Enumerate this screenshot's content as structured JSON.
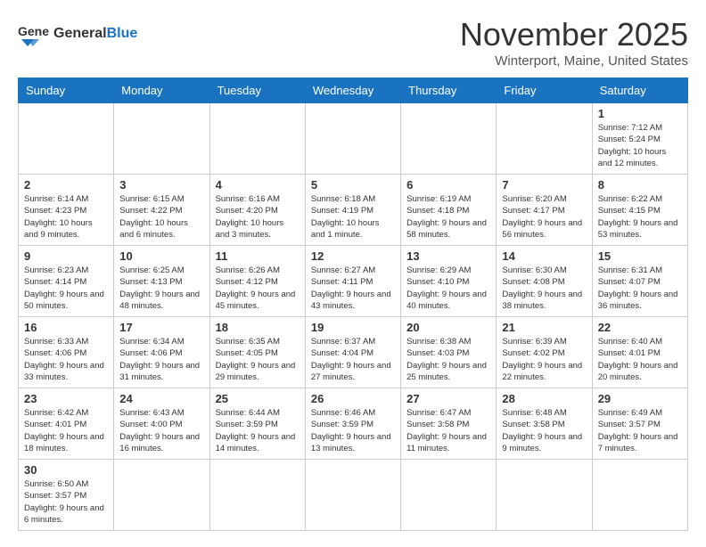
{
  "logo": {
    "general": "General",
    "blue": "Blue"
  },
  "title": "November 2025",
  "location": "Winterport, Maine, United States",
  "days_header": [
    "Sunday",
    "Monday",
    "Tuesday",
    "Wednesday",
    "Thursday",
    "Friday",
    "Saturday"
  ],
  "weeks": [
    [
      {
        "day": "",
        "info": ""
      },
      {
        "day": "",
        "info": ""
      },
      {
        "day": "",
        "info": ""
      },
      {
        "day": "",
        "info": ""
      },
      {
        "day": "",
        "info": ""
      },
      {
        "day": "",
        "info": ""
      },
      {
        "day": "1",
        "info": "Sunrise: 7:12 AM\nSunset: 5:24 PM\nDaylight: 10 hours and 12 minutes."
      }
    ],
    [
      {
        "day": "2",
        "info": "Sunrise: 6:14 AM\nSunset: 4:23 PM\nDaylight: 10 hours and 9 minutes."
      },
      {
        "day": "3",
        "info": "Sunrise: 6:15 AM\nSunset: 4:22 PM\nDaylight: 10 hours and 6 minutes."
      },
      {
        "day": "4",
        "info": "Sunrise: 6:16 AM\nSunset: 4:20 PM\nDaylight: 10 hours and 3 minutes."
      },
      {
        "day": "5",
        "info": "Sunrise: 6:18 AM\nSunset: 4:19 PM\nDaylight: 10 hours and 1 minute."
      },
      {
        "day": "6",
        "info": "Sunrise: 6:19 AM\nSunset: 4:18 PM\nDaylight: 9 hours and 58 minutes."
      },
      {
        "day": "7",
        "info": "Sunrise: 6:20 AM\nSunset: 4:17 PM\nDaylight: 9 hours and 56 minutes."
      },
      {
        "day": "8",
        "info": "Sunrise: 6:22 AM\nSunset: 4:15 PM\nDaylight: 9 hours and 53 minutes."
      }
    ],
    [
      {
        "day": "9",
        "info": "Sunrise: 6:23 AM\nSunset: 4:14 PM\nDaylight: 9 hours and 50 minutes."
      },
      {
        "day": "10",
        "info": "Sunrise: 6:25 AM\nSunset: 4:13 PM\nDaylight: 9 hours and 48 minutes."
      },
      {
        "day": "11",
        "info": "Sunrise: 6:26 AM\nSunset: 4:12 PM\nDaylight: 9 hours and 45 minutes."
      },
      {
        "day": "12",
        "info": "Sunrise: 6:27 AM\nSunset: 4:11 PM\nDaylight: 9 hours and 43 minutes."
      },
      {
        "day": "13",
        "info": "Sunrise: 6:29 AM\nSunset: 4:10 PM\nDaylight: 9 hours and 40 minutes."
      },
      {
        "day": "14",
        "info": "Sunrise: 6:30 AM\nSunset: 4:08 PM\nDaylight: 9 hours and 38 minutes."
      },
      {
        "day": "15",
        "info": "Sunrise: 6:31 AM\nSunset: 4:07 PM\nDaylight: 9 hours and 36 minutes."
      }
    ],
    [
      {
        "day": "16",
        "info": "Sunrise: 6:33 AM\nSunset: 4:06 PM\nDaylight: 9 hours and 33 minutes."
      },
      {
        "day": "17",
        "info": "Sunrise: 6:34 AM\nSunset: 4:06 PM\nDaylight: 9 hours and 31 minutes."
      },
      {
        "day": "18",
        "info": "Sunrise: 6:35 AM\nSunset: 4:05 PM\nDaylight: 9 hours and 29 minutes."
      },
      {
        "day": "19",
        "info": "Sunrise: 6:37 AM\nSunset: 4:04 PM\nDaylight: 9 hours and 27 minutes."
      },
      {
        "day": "20",
        "info": "Sunrise: 6:38 AM\nSunset: 4:03 PM\nDaylight: 9 hours and 25 minutes."
      },
      {
        "day": "21",
        "info": "Sunrise: 6:39 AM\nSunset: 4:02 PM\nDaylight: 9 hours and 22 minutes."
      },
      {
        "day": "22",
        "info": "Sunrise: 6:40 AM\nSunset: 4:01 PM\nDaylight: 9 hours and 20 minutes."
      }
    ],
    [
      {
        "day": "23",
        "info": "Sunrise: 6:42 AM\nSunset: 4:01 PM\nDaylight: 9 hours and 18 minutes."
      },
      {
        "day": "24",
        "info": "Sunrise: 6:43 AM\nSunset: 4:00 PM\nDaylight: 9 hours and 16 minutes."
      },
      {
        "day": "25",
        "info": "Sunrise: 6:44 AM\nSunset: 3:59 PM\nDaylight: 9 hours and 14 minutes."
      },
      {
        "day": "26",
        "info": "Sunrise: 6:46 AM\nSunset: 3:59 PM\nDaylight: 9 hours and 13 minutes."
      },
      {
        "day": "27",
        "info": "Sunrise: 6:47 AM\nSunset: 3:58 PM\nDaylight: 9 hours and 11 minutes."
      },
      {
        "day": "28",
        "info": "Sunrise: 6:48 AM\nSunset: 3:58 PM\nDaylight: 9 hours and 9 minutes."
      },
      {
        "day": "29",
        "info": "Sunrise: 6:49 AM\nSunset: 3:57 PM\nDaylight: 9 hours and 7 minutes."
      }
    ],
    [
      {
        "day": "30",
        "info": "Sunrise: 6:50 AM\nSunset: 3:57 PM\nDaylight: 9 hours and 6 minutes."
      },
      {
        "day": "",
        "info": ""
      },
      {
        "day": "",
        "info": ""
      },
      {
        "day": "",
        "info": ""
      },
      {
        "day": "",
        "info": ""
      },
      {
        "day": "",
        "info": ""
      },
      {
        "day": "",
        "info": ""
      }
    ]
  ]
}
